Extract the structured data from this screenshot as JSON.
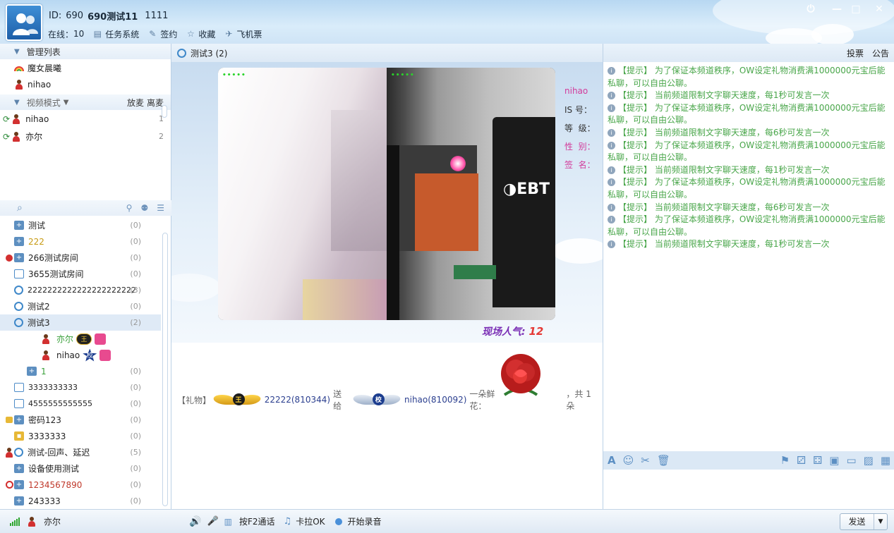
{
  "header": {
    "id_label": "ID:",
    "id_value": "690",
    "name": "690测试11",
    "extra": "1111",
    "online_label": "在线：",
    "online_count": "10",
    "toolbar": [
      "任务系统",
      "签约",
      "收藏",
      "飞机票"
    ],
    "window_buttons": [
      "⏻",
      "—",
      "□",
      "✕"
    ]
  },
  "left": {
    "admin_title": "管理列表",
    "admins": [
      "魔女晨曦",
      "nihao"
    ],
    "video_mode_label": "视频模式",
    "video_mode_actions": [
      "放麦",
      "离麦"
    ],
    "mic_queue": [
      {
        "name": "nihao",
        "index": "1"
      },
      {
        "name": "亦尔",
        "index": "2"
      }
    ],
    "rooms": [
      {
        "name": "测试",
        "count": "(0)",
        "icon": "plus-box-icon"
      },
      {
        "name": "222",
        "count": "(0)",
        "icon": "plus-box-icon",
        "color": "#c79a12"
      },
      {
        "name": "266测试房间",
        "count": "(0)",
        "icon": "plus-box-icon",
        "prefix": "no-entry"
      },
      {
        "name": "3655测试房间",
        "count": "(0)",
        "icon": "video-icon"
      },
      {
        "name": "2222222222222222222222",
        "count": "(3)",
        "icon": "webcam-icon"
      },
      {
        "name": "测试2",
        "count": "(0)",
        "icon": "webcam-icon"
      },
      {
        "name": "测试3",
        "count": "(2)",
        "icon": "webcam-icon",
        "selected": true
      },
      {
        "name": "3333333333",
        "count": "(0)",
        "icon": "video-icon"
      },
      {
        "name": "4555555555555",
        "count": "(0)",
        "icon": "video-icon"
      },
      {
        "name": "密码123",
        "count": "(0)",
        "icon": "plus-box-icon",
        "prefix": "lock"
      },
      {
        "name": "3333333",
        "count": "(0)",
        "icon": "lock-box-icon"
      },
      {
        "name": "测试-回声、延迟",
        "count": "(5)",
        "icon": "webcam-icon",
        "prefix": "user"
      },
      {
        "name": "设备使用测试",
        "count": "(0)",
        "icon": "plus-box-icon"
      },
      {
        "name": "1234567890",
        "count": "(0)",
        "icon": "plus-box-icon",
        "prefix": "forbidden",
        "color": "#c0392b"
      },
      {
        "name": "243333",
        "count": "(0)",
        "icon": "plus-box-icon"
      }
    ],
    "room_members": [
      {
        "name": "亦尔",
        "badge": "王",
        "color": "#3aa03a"
      },
      {
        "name": "nihao",
        "badge": "校",
        "color": "#333333"
      }
    ],
    "sub_room": {
      "name": "1",
      "count": "(0)"
    }
  },
  "center": {
    "room_title": "测试3 (2)",
    "signal_dots": "•••••",
    "profile_name": "nihao",
    "profile_fields": [
      "IS 号：",
      "等  级：",
      "性  别：",
      "签  名："
    ],
    "popularity_label": "现场人气:",
    "popularity_value": "12",
    "gift": {
      "tag": "【礼物】",
      "sender": "22222(810344)",
      "verb": "送给",
      "receiver": "nihao(810092)",
      "item": "一朵鲜花：",
      "total": "，共 1 朵"
    }
  },
  "right": {
    "tabs": [
      "投票",
      "公告"
    ],
    "messages": [
      "【提示】 为了保证本频道秩序，OW设定礼物消费满1000000元宝后能私聊，可以自由公聊。",
      "【提示】 当前频道限制文字聊天速度，每1秒可发言一次",
      "【提示】 为了保证本频道秩序，OW设定礼物消费满1000000元宝后能私聊，可以自由公聊。",
      "【提示】 当前频道限制文字聊天速度，每6秒可发言一次",
      "【提示】 为了保证本频道秩序，OW设定礼物消费满1000000元宝后能私聊，可以自由公聊。",
      "【提示】 当前频道限制文字聊天速度，每1秒可发言一次",
      "【提示】 为了保证本频道秩序，OW设定礼物消费满1000000元宝后能私聊，可以自由公聊。",
      "【提示】 当前频道限制文字聊天速度，每6秒可发言一次",
      "【提示】 为了保证本频道秩序，OW设定礼物消费满1000000元宝后能私聊，可以自由公聊。",
      "【提示】 当前频道限制文字聊天速度，每1秒可发言一次"
    ]
  },
  "footer": {
    "user": "亦尔",
    "f2_label": "按F2通话",
    "karaoke_label": "卡拉OK",
    "record_label": "开始录音",
    "send_label": "发送"
  },
  "colors": {
    "accent": "#3f88c9",
    "message_green": "#49a64a",
    "profile_pink": "#d23b9a",
    "popularity_purple": "#7a2fb5"
  }
}
